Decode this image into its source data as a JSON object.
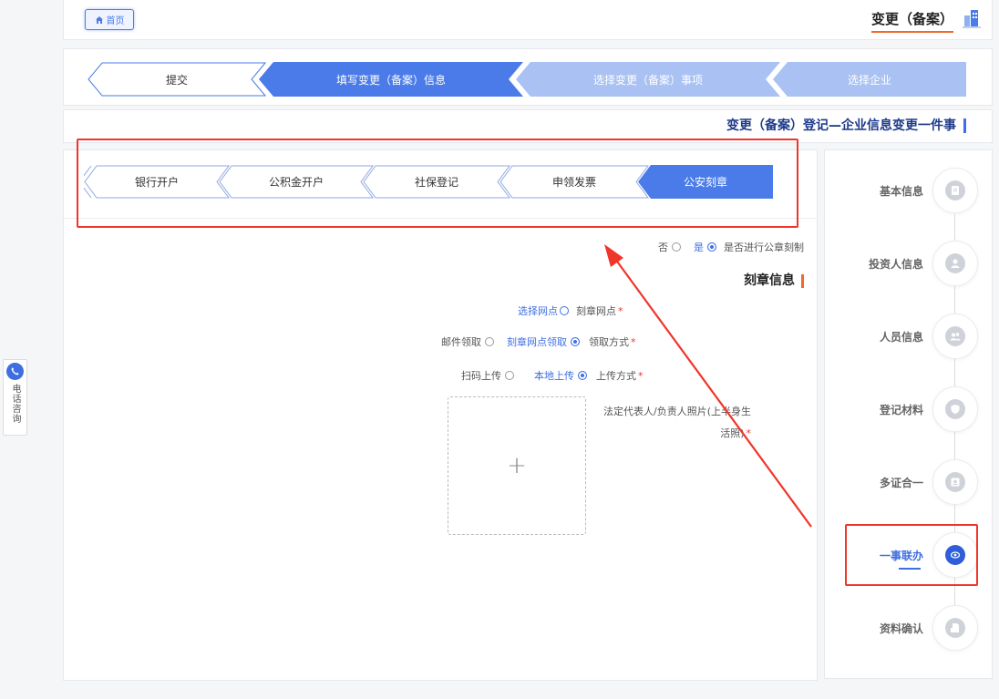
{
  "header": {
    "home_label": "首页",
    "title": "变更（备案）"
  },
  "main_steps": [
    {
      "label": "选择企业",
      "state": "light"
    },
    {
      "label": "选择变更（备案）事项",
      "state": "light"
    },
    {
      "label": "填写变更（备案）信息",
      "state": "active"
    },
    {
      "label": "提交",
      "state": "inactive"
    }
  ],
  "subtitle": "变更（备案）登记—企业信息变更一件事",
  "sub_steps": [
    {
      "label": "公安刻章",
      "state": "active"
    },
    {
      "label": "申领发票",
      "state": "inactive"
    },
    {
      "label": "社保登记",
      "state": "inactive"
    },
    {
      "label": "公积金开户",
      "state": "inactive"
    },
    {
      "label": "银行开户",
      "state": "inactive"
    }
  ],
  "form": {
    "question": "是否进行公章刻制",
    "yes": "是",
    "no": "否",
    "section_title": "刻章信息",
    "outlet_label": "刻章网点",
    "outlet_link": "选择网点",
    "pickup_label": "领取方式",
    "pickup_opt1": "刻章网点领取",
    "pickup_opt2": "邮件领取",
    "upload_label": "上传方式",
    "upload_opt1": "本地上传",
    "upload_opt2": "扫码上传",
    "photo_label": "法定代表人/负责人照片(上半身生活照)",
    "upload_plus": "+"
  },
  "side_nav": [
    {
      "label": "基本信息",
      "icon": "document-icon",
      "active": false
    },
    {
      "label": "投资人信息",
      "icon": "investor-icon",
      "active": false
    },
    {
      "label": "人员信息",
      "icon": "people-icon",
      "active": false
    },
    {
      "label": "登记材料",
      "icon": "shield-icon",
      "active": false
    },
    {
      "label": "多证合一",
      "icon": "certificate-icon",
      "active": false
    },
    {
      "label": "一事联办",
      "icon": "link-icon",
      "active": true
    },
    {
      "label": "资料确认",
      "icon": "file-confirm-icon",
      "active": false
    }
  ],
  "float_widget": {
    "label": "电话咨询"
  },
  "colors": {
    "primary": "#3e6fe0",
    "step_active": "#4a7be8",
    "step_light": "#a9c1f3",
    "accent": "#f06a2c",
    "annotation_red": "#f0352a"
  }
}
